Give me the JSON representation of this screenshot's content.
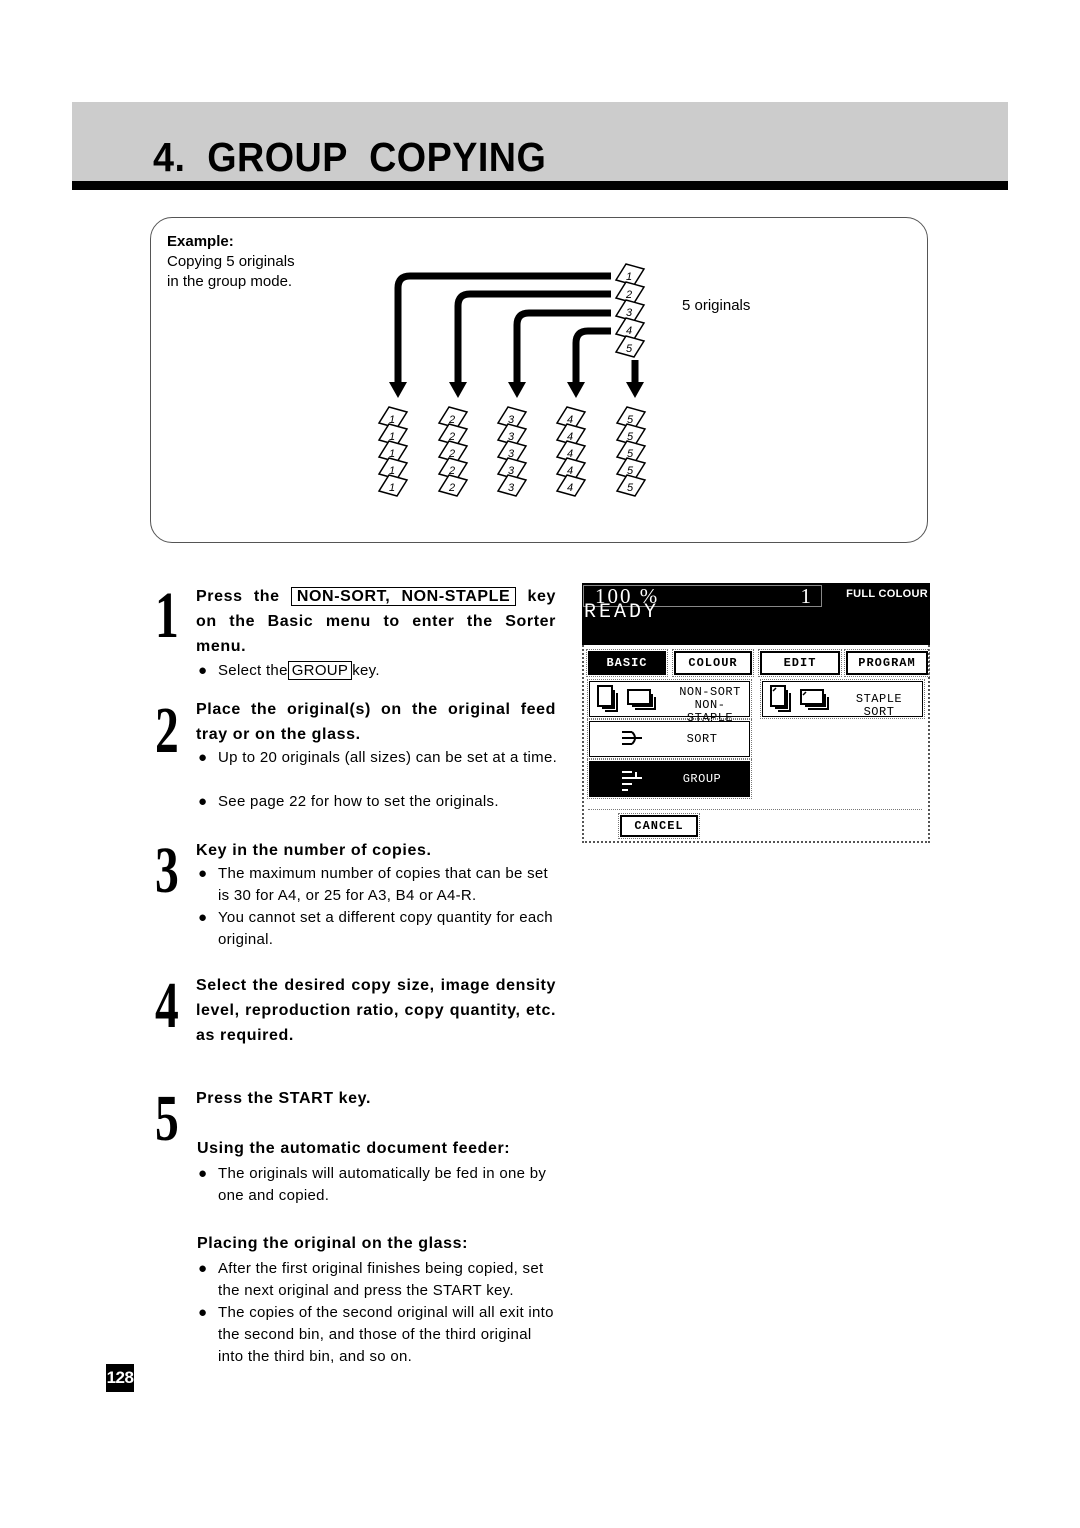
{
  "header": {
    "title": "4.  GROUP  COPYING"
  },
  "example": {
    "label": "Example:",
    "lines": [
      "Copying 5 originals",
      "in the group mode."
    ],
    "originals_label": "5 originals",
    "originals": [
      "1",
      "2",
      "3",
      "4",
      "5"
    ],
    "bins": [
      {
        "number": "1",
        "copies": 5
      },
      {
        "number": "2",
        "copies": 5
      },
      {
        "number": "3",
        "copies": 5
      },
      {
        "number": "4",
        "copies": 5
      },
      {
        "number": "5",
        "copies": 5
      }
    ]
  },
  "steps": [
    {
      "number": "1",
      "head_pre": "Press the ",
      "head_key": "NON-SORT, NON-STAPLE",
      "head_post": " key on the Basic menu to enter the Sorter menu.",
      "bullets": [
        {
          "pre": "Select the",
          "key": "GROUP",
          "post": "key."
        }
      ]
    },
    {
      "number": "2",
      "head": "Place the original(s) on the original feed tray or on the glass.",
      "bullets": [
        "Up to 20 originals (all sizes) can be set at a time.",
        "See page 22 for how to set the originals."
      ]
    },
    {
      "number": "3",
      "head": "Key in the number of copies.",
      "bullets": [
        "The maximum number of copies that can be set is 30 for A4, or 25 for A3, B4 or A4-R.",
        "You cannot set a different copy quantity for each original."
      ]
    },
    {
      "number": "4",
      "head": "Select the desired copy size, image density level, reproduction ratio, copy quantity, etc. as required."
    },
    {
      "number": "5",
      "head": "Press the START key.",
      "sections": [
        {
          "title": "Using the automatic document feeder:",
          "bullets": [
            "The originals will automatically be fed in one by one and copied."
          ]
        },
        {
          "title": "Placing the original on the glass:",
          "bullets": [
            "After the first original finishes being copied, set the next original and press the START key.",
            "The copies of the second original will all exit into the second bin, and those of the third original into the third bin, and so on."
          ]
        }
      ]
    }
  ],
  "panel": {
    "ratio": "100  %",
    "quantity": "1",
    "colour_mode": "FULL COLOUR",
    "status": "READY",
    "tabs": [
      {
        "label": "BASIC",
        "active": true
      },
      {
        "label": "COLOUR",
        "active": false
      },
      {
        "label": "EDIT",
        "active": false
      },
      {
        "label": "PROGRAM",
        "active": false
      }
    ],
    "buttons": {
      "non_sort": [
        "NON-SORT",
        "NON-STAPLE"
      ],
      "staple_sort": "STAPLE SORT",
      "sort": "SORT",
      "group": "GROUP",
      "cancel": "CANCEL"
    },
    "selected": "GROUP"
  },
  "page_number": "128"
}
